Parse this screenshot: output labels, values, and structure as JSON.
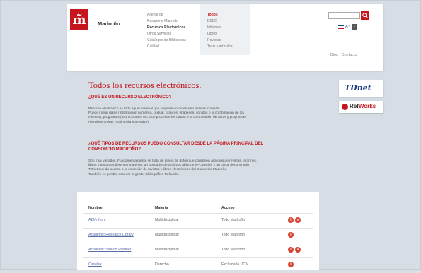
{
  "header": {
    "logo_glyph": "m̃",
    "brand": "Madroño",
    "nav1": [
      "Acerca de",
      "Pasaporte Madroño",
      "Recursos Electrónicos",
      "Otros Servicios",
      "Catálogos de Bibliotecas",
      "Calidad"
    ],
    "nav2": [
      "Todos",
      "BBDD",
      "Informes",
      "Libros",
      "Revistas",
      "Tesis y artículos"
    ],
    "search_placeholder": "",
    "search_icon": "search-icon",
    "lang_label": "A⁺",
    "util_links": "Blog  |  Contacto"
  },
  "main": {
    "title": "Todos los recursos electrónicos.",
    "q1": "¿QUÉ ES UN RECURSO ELECTRÓNICO?",
    "p1": [
      "Recurso electrónico es todo aquel material que requiere un ordenador para su consulta.",
      "Puede incluir datos (información numérica, textual, gráficos, imágenes, sonidos o la combinación de los",
      "mismos), programas (instrucciones, etc. que procesan los datos) o la combinación de datos y programas",
      "(servicios online, multimedia interactivo)."
    ],
    "q2_lines": [
      "¿QUÉ TIPOS DE RECURSOS PUEDO CONSULTAR DESDE LA PÁGINA PRINCIPAL DEL",
      "CONSORCIO MADROÑO?"
    ],
    "p2": [
      "Son muy variados. Fundamentalmente se trata de bases de datos que contienen artículos de revistas, informes,",
      "libros o texto de diferentes materias; un buscador de archivos abiertos (e-Ciencia); y un portal denominado",
      "TDnet que da acceso a la colección de revistas y libros electrónicos del Consorcio Madroño.",
      "También es posible acceder al gestor bibliográfico Refworks."
    ]
  },
  "table": {
    "headers": [
      "Nombre",
      "Materia",
      "Acceso"
    ],
    "rows": [
      {
        "name": "ABI/Inform",
        "materia": "Multidisciplinar",
        "acceso": "Todo Madroño",
        "icons": 2
      },
      {
        "name": "Academic Research Library",
        "materia": "Multidisciplinar",
        "acceso": "Todo Madroño",
        "icons": 1
      },
      {
        "name": "Academic Search Premier",
        "materia": "Multidisciplinar",
        "acceso": "Todo Madroño",
        "icons": 2
      },
      {
        "name": "Caselex",
        "materia": "Derecho",
        "acceso": "Excluida la UCM",
        "icons": 1
      }
    ]
  },
  "side": {
    "tdnet_label": "TDnet",
    "refworks_ref": "Ref",
    "refworks_works": "Works"
  },
  "colors": {
    "accent": "#c4161c",
    "background": "#d6dde4"
  }
}
